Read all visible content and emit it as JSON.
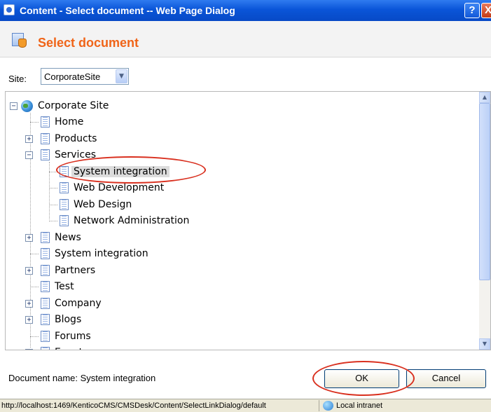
{
  "window": {
    "title": "Content - Select document -- Web Page Dialog",
    "help_label": "?",
    "close_label": "X"
  },
  "header": {
    "title": "Select document"
  },
  "site": {
    "label": "Site:",
    "selected": "CorporateSite",
    "arrow": "▼"
  },
  "tree": {
    "root": "Corporate Site",
    "items": [
      {
        "label": "Home",
        "expander": ""
      },
      {
        "label": "Products",
        "expander": "+"
      },
      {
        "label": "Services",
        "expander": "−"
      },
      {
        "label": "System integration",
        "expander": "",
        "selected": true
      },
      {
        "label": "Web Development",
        "expander": ""
      },
      {
        "label": "Web Design",
        "expander": ""
      },
      {
        "label": "Network Administration",
        "expander": ""
      },
      {
        "label": "News",
        "expander": "+"
      },
      {
        "label": "System integration",
        "expander": ""
      },
      {
        "label": "Partners",
        "expander": "+"
      },
      {
        "label": "Test",
        "expander": ""
      },
      {
        "label": "Company",
        "expander": "+"
      },
      {
        "label": "Blogs",
        "expander": "+"
      },
      {
        "label": "Forums",
        "expander": ""
      },
      {
        "label": "Events",
        "expander": "+"
      }
    ]
  },
  "footer": {
    "document_name": "Document name: System integration",
    "ok_label": "OK",
    "cancel_label": "Cancel"
  },
  "statusbar": {
    "url": "http://localhost:1469/KenticoCMS/CMSDesk/Content/SelectLinkDialog/default",
    "zone": "Local intranet"
  },
  "colors": {
    "title_bar": "#0a55d8",
    "header_title": "#f06418",
    "annotation": "#d9301f"
  }
}
